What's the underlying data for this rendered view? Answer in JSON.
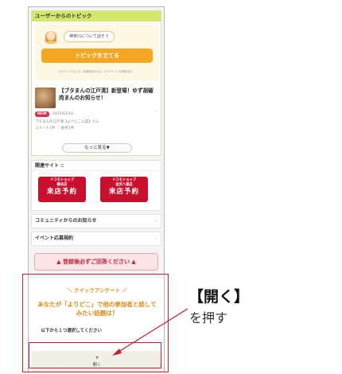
{
  "topics": {
    "header": "ユーザーからのトピック",
    "speech": "神奈川について話そう",
    "create_button": "トピックを立てる",
    "note": "※ログインするとは、新規登録または、dアカウントで新規作成で…",
    "article": {
      "title": "【ブタまんの江戸清】新登場！ゆず胡椒肉まんのお知らせ！",
      "badge": "NEW",
      "date": "2025/02/18",
      "source": "ブタまんの江戸清【よりどこ公認】さん",
      "stats": "コメント1件 ｜ 拍手2件"
    },
    "more_button": "もっと見る▼"
  },
  "related": {
    "header": "関連サイト",
    "ext_icon": "external-link-icon",
    "shops": [
      {
        "name": "ドコモショップ",
        "branch": "磯谷店",
        "cta": "来店予約"
      },
      {
        "name": "ドコモショップ",
        "branch": "金沢八景店",
        "cta": "来店予約"
      }
    ]
  },
  "rows": [
    {
      "label": "コミュニティからのお知らせ"
    },
    {
      "label": "イベント応募規約"
    }
  ],
  "warning": "▲ 登録後必ずご回答ください ▲",
  "survey": {
    "title": "＼ クイックアンケート ／",
    "question": "あなたが「よりどこ」で他の参加者と話してみたい話題は？",
    "instruction": "以下から１つ選択してください",
    "open_caret": "▼",
    "open_label": "開く"
  },
  "annotation": {
    "title": "【開く】",
    "subtitle": "を押す"
  },
  "colors": {
    "accent_green": "#d3e86a",
    "accent_orange": "#f5a623",
    "docomo_red": "#c8102e",
    "annotation_red": "#c8202a",
    "survey_orange": "#e08a12"
  }
}
